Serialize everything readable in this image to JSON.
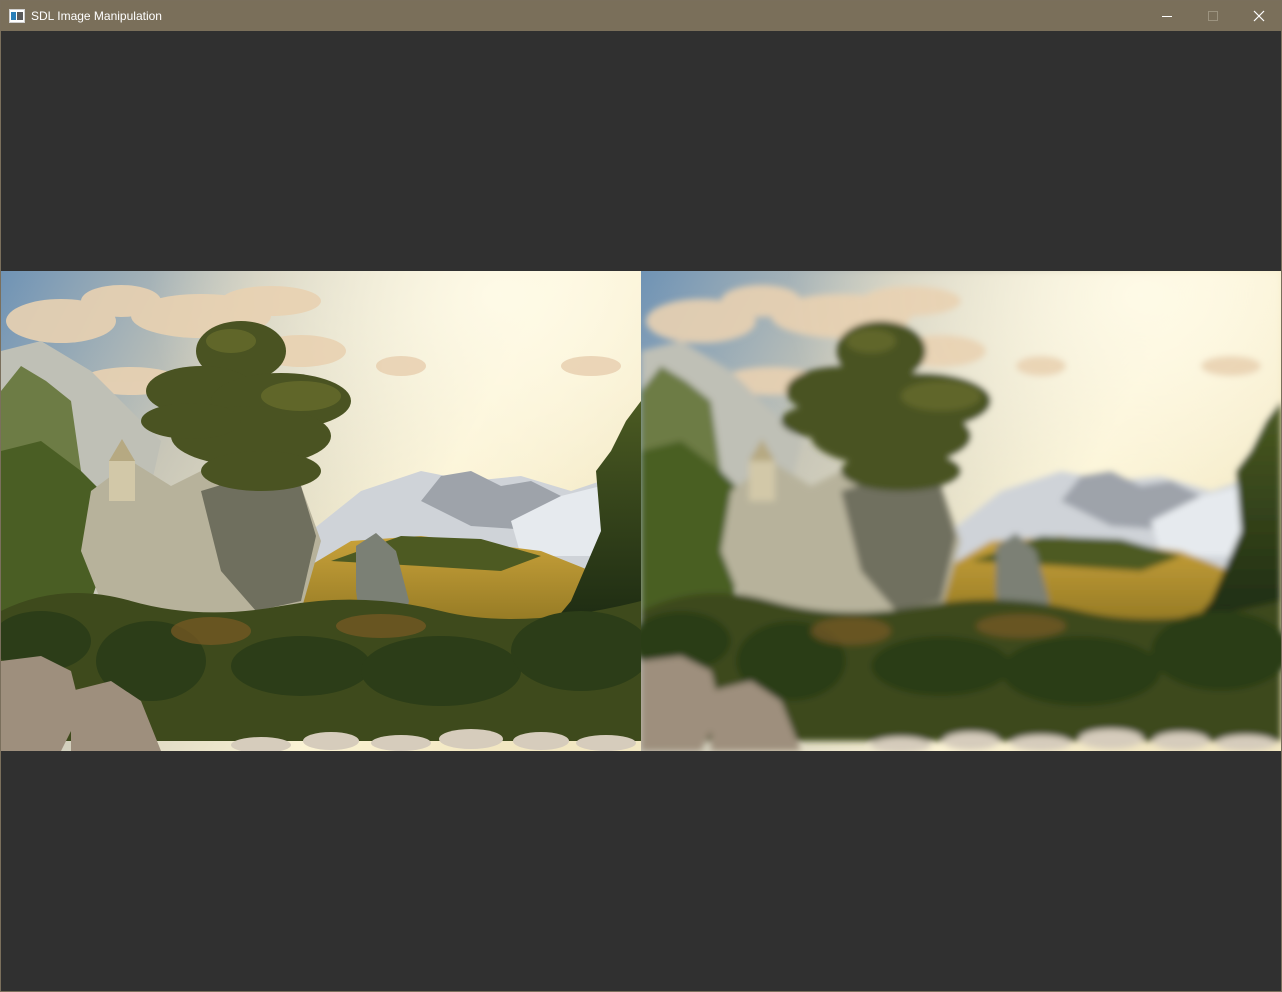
{
  "window": {
    "title": "SDL Image Manipulation",
    "title_bar_color": "#7a6f5a",
    "background_color": "#303030",
    "controls": {
      "minimize_icon": "minimize-icon",
      "maximize_icon": "maximize-icon",
      "close_icon": "close-icon"
    }
  },
  "panes": [
    {
      "name": "original-image",
      "effect": "none"
    },
    {
      "name": "processed-image",
      "effect": "blur"
    }
  ]
}
